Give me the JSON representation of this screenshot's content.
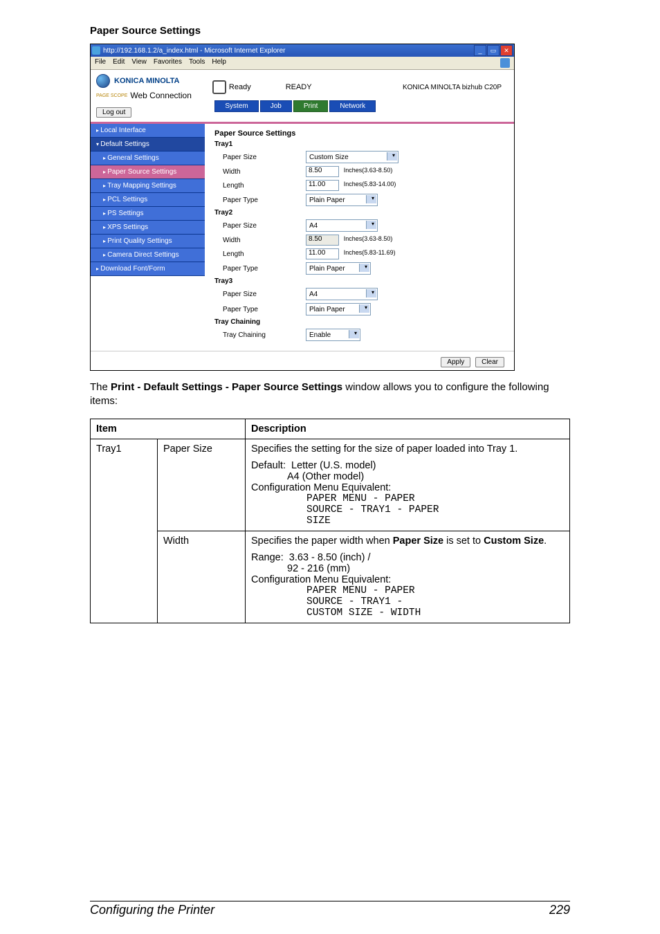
{
  "sectionTitle": "Paper Source Settings",
  "browser": {
    "titlePrefix": "http://192.168.1.2/a_index.html - Microsoft Internet Explorer",
    "menus": [
      "File",
      "Edit",
      "View",
      "Favorites",
      "Tools",
      "Help"
    ]
  },
  "header": {
    "brand": "KONICA MINOLTA",
    "pageScope": "PAGE SCOPE",
    "webConn": "Web Connection",
    "readySmall": "Ready",
    "readyBig": "READY",
    "device": "KONICA MINOLTA bizhub C20P",
    "logout": "Log out"
  },
  "tabs": {
    "system": "System",
    "job": "Job",
    "print": "Print",
    "network": "Network"
  },
  "sidebar": {
    "localInterface": "Local Interface",
    "defaultSettings": "Default Settings",
    "generalSettings": "General Settings",
    "paperSource": "Paper Source Settings",
    "trayMapping": "Tray Mapping Settings",
    "pcl": "PCL Settings",
    "ps": "PS Settings",
    "xps": "XPS Settings",
    "printQuality": "Print Quality Settings",
    "cameraDirect": "Camera Direct Settings",
    "downloadFont": "Download Font/Form"
  },
  "form": {
    "heading": "Paper Source Settings",
    "tray1": "Tray1",
    "tray2": "Tray2",
    "tray3": "Tray3",
    "trayChainingHeading": "Tray Chaining",
    "paperSize": "Paper Size",
    "width": "Width",
    "length": "Length",
    "paperType": "Paper Type",
    "trayChaining": "Tray Chaining",
    "customSize": "Custom Size",
    "a4": "A4",
    "plainPaper": "Plain Paper",
    "enable": "Enable",
    "t1w": "8.50",
    "t1wRange": "Inches(3.63-8.50)",
    "t1l": "11.00",
    "t1lRange": "Inches(5.83-14.00)",
    "t2w": "8.50",
    "t2wRange": "Inches(3.63-8.50)",
    "t2l": "11.00",
    "t2lRange": "Inches(5.83-11.69)",
    "apply": "Apply",
    "clear": "Clear"
  },
  "caption": {
    "pre": "The ",
    "bold": "Print - Default Settings - Paper Source Settings",
    "post": " window allows you to configure the following items:"
  },
  "table": {
    "hItem": "Item",
    "hDesc": "Description",
    "r1c1": "Tray1",
    "r1c2": "Paper Size",
    "r1desc1": "Specifies the setting for the size of paper loaded into Tray 1.",
    "r1default": "Default:",
    "r1defLine1": "Letter (U.S. model)",
    "r1defLine2": "A4 (Other model)",
    "r1cfg": "Configuration Menu Equivalent:",
    "r1m1": "PAPER MENU - PAPER",
    "r1m2": "SOURCE - TRAY1 - PAPER",
    "r1m3": "SIZE",
    "r2c2": "Width",
    "r2descPre": "Specifies the paper width when ",
    "r2b1": "Paper Size",
    "r2mid": " is set to ",
    "r2b2": "Custom Size",
    "r2end": ".",
    "r2range": "Range:",
    "r2rLine1": "3.63 - 8.50 (inch) /",
    "r2rLine2": "92 - 216 (mm)",
    "r2cfg": "Configuration Menu Equivalent:",
    "r2m1": "PAPER MENU - PAPER",
    "r2m2": "SOURCE - TRAY1 -",
    "r2m3": "CUSTOM SIZE - WIDTH"
  },
  "footer": {
    "left": "Configuring the Printer",
    "right": "229"
  }
}
